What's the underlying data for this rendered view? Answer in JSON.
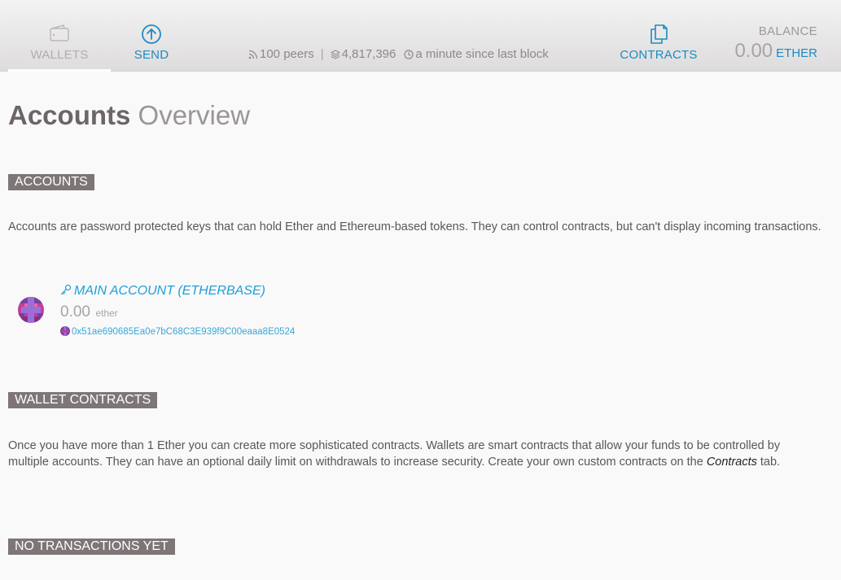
{
  "nav": {
    "wallets_label": "WALLETS",
    "send_label": "SEND",
    "contracts_label": "CONTRACTS"
  },
  "status": {
    "peers": "100 peers",
    "separator": "|",
    "block_number": "4,817,396",
    "last_block": "a minute since last block"
  },
  "balance": {
    "label": "BALANCE",
    "amount": "0.00",
    "unit": "ETHER"
  },
  "page_title": {
    "strong": "Accounts",
    "light": "Overview"
  },
  "accounts_section": {
    "heading": "ACCOUNTS",
    "description": "Accounts are password protected keys that can hold Ether and Ethereum-based tokens. They can control contracts, but can't display incoming transactions.",
    "items": [
      {
        "name": "MAIN ACCOUNT (ETHERBASE)",
        "balance": "0.00",
        "unit": "ether",
        "address": "0x51ae690685Ea0e7bC68C3E939f9C00eaaa8E0524"
      }
    ]
  },
  "wallet_contracts_section": {
    "heading": "WALLET CONTRACTS",
    "description_pre": "Once you have more than 1 Ether you can create more sophisticated contracts. Wallets are smart contracts that allow your funds to be controlled by multiple accounts. They can have an optional daily limit on withdrawals to increase security. Create your own custom contracts on the ",
    "description_link": "Contracts",
    "description_post": " tab."
  },
  "transactions_section": {
    "heading": "NO TRANSACTIONS YET"
  },
  "colors": {
    "accent": "#1c8bc3",
    "link": "#1c9fd8",
    "section_tag_bg": "#7d7576",
    "inactive_nav": "#b3adad"
  },
  "icons": {
    "wallets": "wallet-icon",
    "send": "arrow-up-circle-icon",
    "contracts": "documents-icon",
    "peers": "rss-icon",
    "blocks": "layers-icon",
    "time": "clock-icon",
    "account": "key-icon"
  }
}
